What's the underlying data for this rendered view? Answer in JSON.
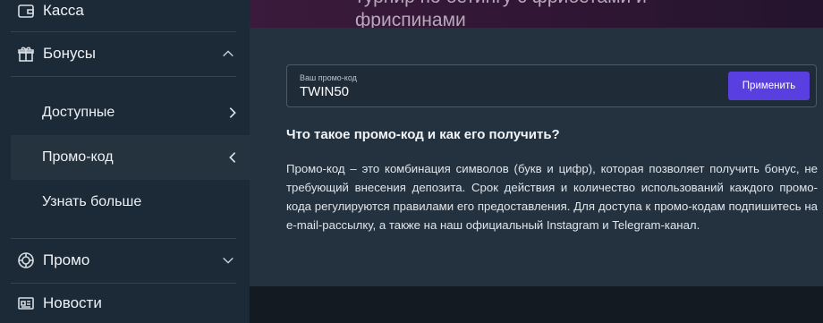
{
  "banner": {
    "title_line1": "турнир по бетингу с фрибетами и",
    "title_line2": "фриспинами"
  },
  "sidebar": {
    "items": [
      {
        "label": "Касса",
        "icon": "wallet-icon"
      },
      {
        "label": "Бонусы",
        "icon": "gift-icon",
        "expanded": true
      },
      {
        "label": "Промо",
        "icon": "globe-icon",
        "expanded": false
      },
      {
        "label": "Новости",
        "icon": "news-icon"
      }
    ],
    "bonus_subitems": [
      {
        "label": "Доступные"
      },
      {
        "label": "Промо-код",
        "active": true
      },
      {
        "label": "Узнать больше"
      }
    ]
  },
  "promo": {
    "caption": "Ваш промо-код",
    "value": "TWIN50",
    "apply_label": "Применить"
  },
  "faq": {
    "title": "Что такое промо-код и как его получить?",
    "body": "Промо-код – это комбинация символов (букв и цифр), которая позволяет получить бонус, не требующий внесения депозита. Срок действия и количество использований каждого промо-кода регулируются правилами его предоставления. Для доступа к промо-кодам подпишитесь на e-mail-рассылку, а также на наш официальный Instagram и Telegram-канал."
  },
  "colors": {
    "sidebar_bg": "#1c2a37",
    "active_bg": "#25333f",
    "content_bg": "#243240",
    "accent": "#5a3fe0"
  }
}
